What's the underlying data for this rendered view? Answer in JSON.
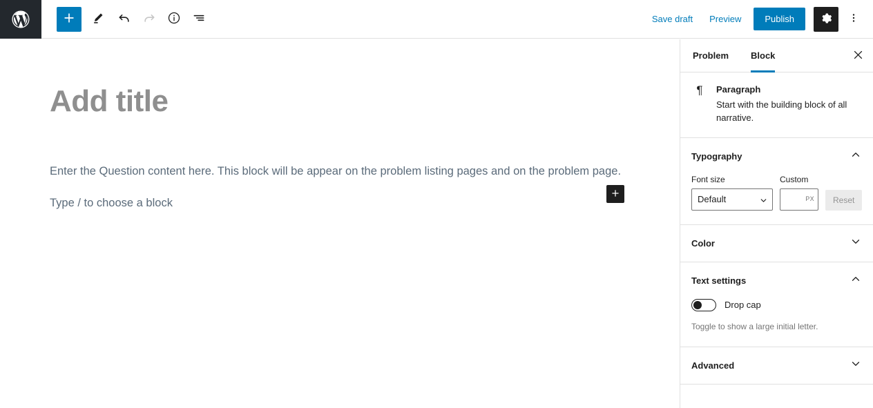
{
  "header": {
    "logo_icon": "wordpress-logo-icon",
    "tools": [
      {
        "name": "add-block-button",
        "icon": "plus-icon",
        "label": "Add block"
      },
      {
        "name": "tools-pencil-button",
        "icon": "pencil-icon",
        "label": "Tools"
      },
      {
        "name": "undo-button",
        "icon": "undo-arrow-icon",
        "label": "Undo"
      },
      {
        "name": "redo-button",
        "icon": "redo-arrow-icon",
        "label": "Redo"
      },
      {
        "name": "details-button",
        "icon": "info-circle-icon",
        "label": "Details"
      },
      {
        "name": "list-view-button",
        "icon": "list-view-icon",
        "label": "List view"
      }
    ],
    "save_draft_label": "Save draft",
    "preview_label": "Preview",
    "publish_label": "Publish",
    "settings_icon": "gear-icon",
    "more_options_icon": "kebab-vertical-icon",
    "accent_color": "#007cba",
    "dark_color": "#1e1e1e",
    "logo_bg_color": "#23282d"
  },
  "editor": {
    "title_placeholder": "Add title",
    "blocks": [
      {
        "text": "Enter the Question content here. This block will be appear on the problem listing pages and on the problem page."
      },
      {
        "text": "Type / to choose a block"
      }
    ],
    "appender_icon": "plus-icon"
  },
  "sidebar": {
    "tabs": [
      {
        "label": "Problem",
        "active": false
      },
      {
        "label": "Block",
        "active": true
      }
    ],
    "close_icon": "close-x-icon",
    "block_card": {
      "icon": "paragraph-pilcrow-icon",
      "icon_glyph": "¶",
      "title": "Paragraph",
      "description": "Start with the building block of all narrative."
    },
    "panels": [
      {
        "title": "Typography",
        "expanded": true,
        "toggle_icon": "chevron-up-icon",
        "font_size_label": "Font size",
        "font_size_value": "Default",
        "font_size_options": [
          "Default"
        ],
        "custom_label": "Custom",
        "custom_value": "",
        "custom_unit": "PX",
        "reset_label": "Reset"
      },
      {
        "title": "Color",
        "expanded": false,
        "toggle_icon": "chevron-down-icon"
      },
      {
        "title": "Text settings",
        "expanded": true,
        "toggle_icon": "chevron-up-icon",
        "drop_cap_label": "Drop cap",
        "drop_cap_enabled": false,
        "help_text": "Toggle to show a large initial letter."
      },
      {
        "title": "Advanced",
        "expanded": false,
        "toggle_icon": "chevron-down-icon"
      }
    ]
  }
}
